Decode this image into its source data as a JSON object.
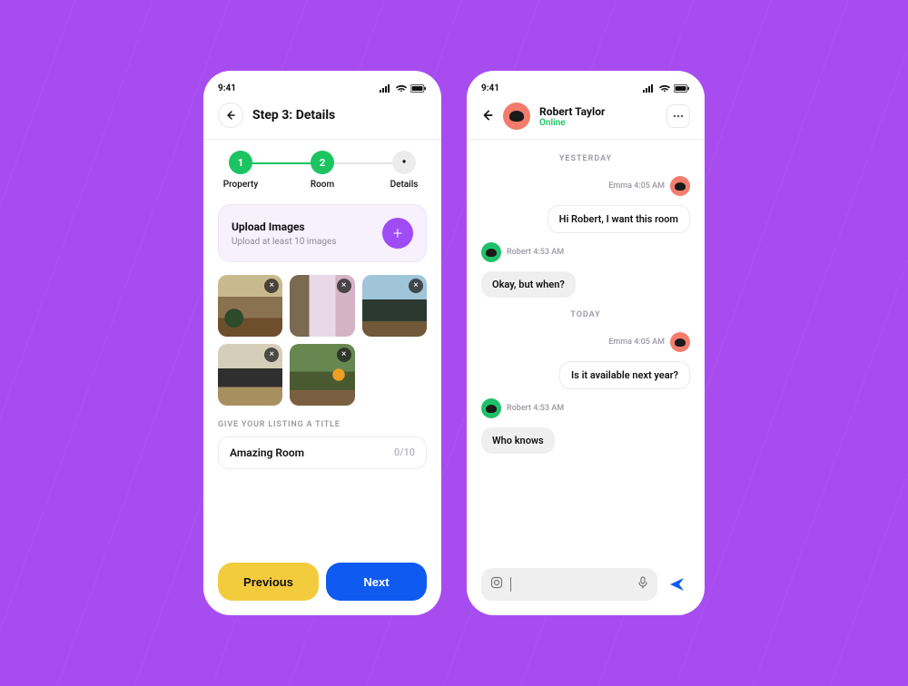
{
  "status": {
    "time": "9:41"
  },
  "screen1": {
    "title": "Step 3: Details",
    "steps": [
      {
        "num": "1",
        "label": "Property",
        "state": "done"
      },
      {
        "num": "2",
        "label": "Room",
        "state": "done"
      },
      {
        "num": "",
        "label": "Details",
        "state": "pending"
      }
    ],
    "upload": {
      "title": "Upload Images",
      "subtitle": "Upload at least 10 images"
    },
    "image_count": 5,
    "section_label": "GIVE YOUR LISTING A TITLE",
    "title_input": {
      "value": "Amazing Room",
      "counter": "0/10"
    },
    "buttons": {
      "prev": "Previous",
      "next": "Next"
    }
  },
  "screen2": {
    "contact": {
      "name": "Robert Taylor",
      "status": "Online"
    },
    "separators": {
      "yesterday": "YESTERDAY",
      "today": "TODAY"
    },
    "msgs": {
      "m1": {
        "meta": "Emma 4:05 AM",
        "text": "Hi Robert, I want this room"
      },
      "m2": {
        "meta": "Robert 4:53 AM",
        "text": "Okay, but when?"
      },
      "m3": {
        "meta": "Emma 4:05 AM",
        "text": "Is it available next year?"
      },
      "m4": {
        "meta": "Robert 4:53 AM",
        "text": "Who knows"
      }
    }
  }
}
